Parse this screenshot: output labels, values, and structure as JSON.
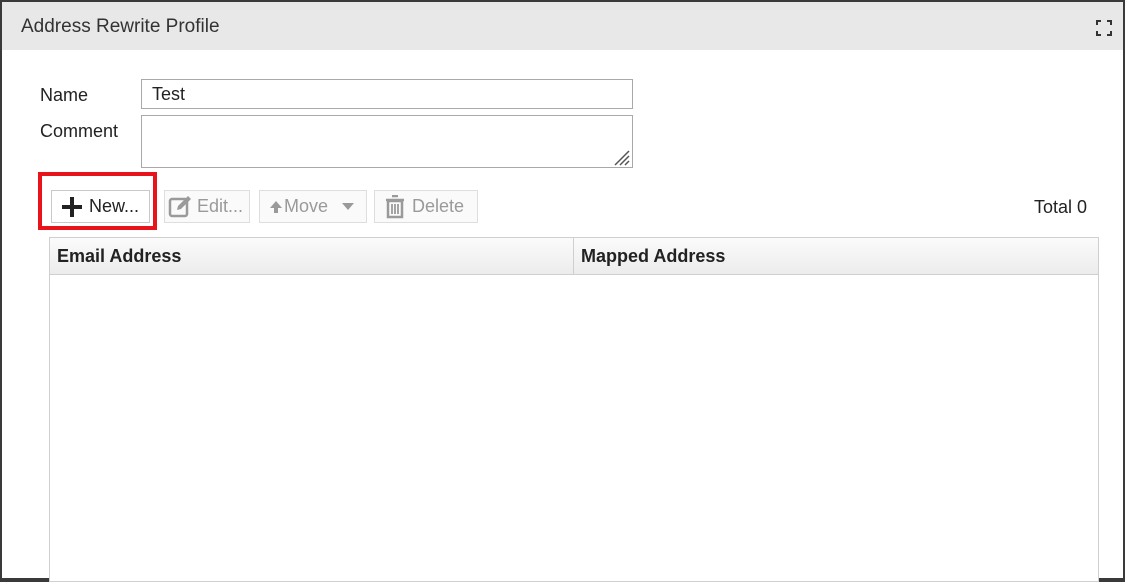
{
  "dialog": {
    "title": "Address Rewrite Profile",
    "maximize_icon": "maximize-icon"
  },
  "form": {
    "name_label": "Name",
    "name_value": "Test",
    "comment_label": "Comment",
    "comment_value": ""
  },
  "toolbar": {
    "new_label": "New...",
    "edit_label": "Edit...",
    "move_label": "Move",
    "delete_label": "Delete",
    "total_label": "Total 0",
    "icons": {
      "new": "plus-icon",
      "edit": "edit-icon",
      "move": "arrow-up-icon",
      "move_dropdown": "caret-down-icon",
      "delete": "trash-icon"
    }
  },
  "table": {
    "columns": [
      "Email Address",
      "Mapped Address"
    ],
    "rows": []
  },
  "colors": {
    "highlight": "#e8141b",
    "titlebar": "#e8e8e8",
    "disabled_text": "#9a9a9a"
  }
}
